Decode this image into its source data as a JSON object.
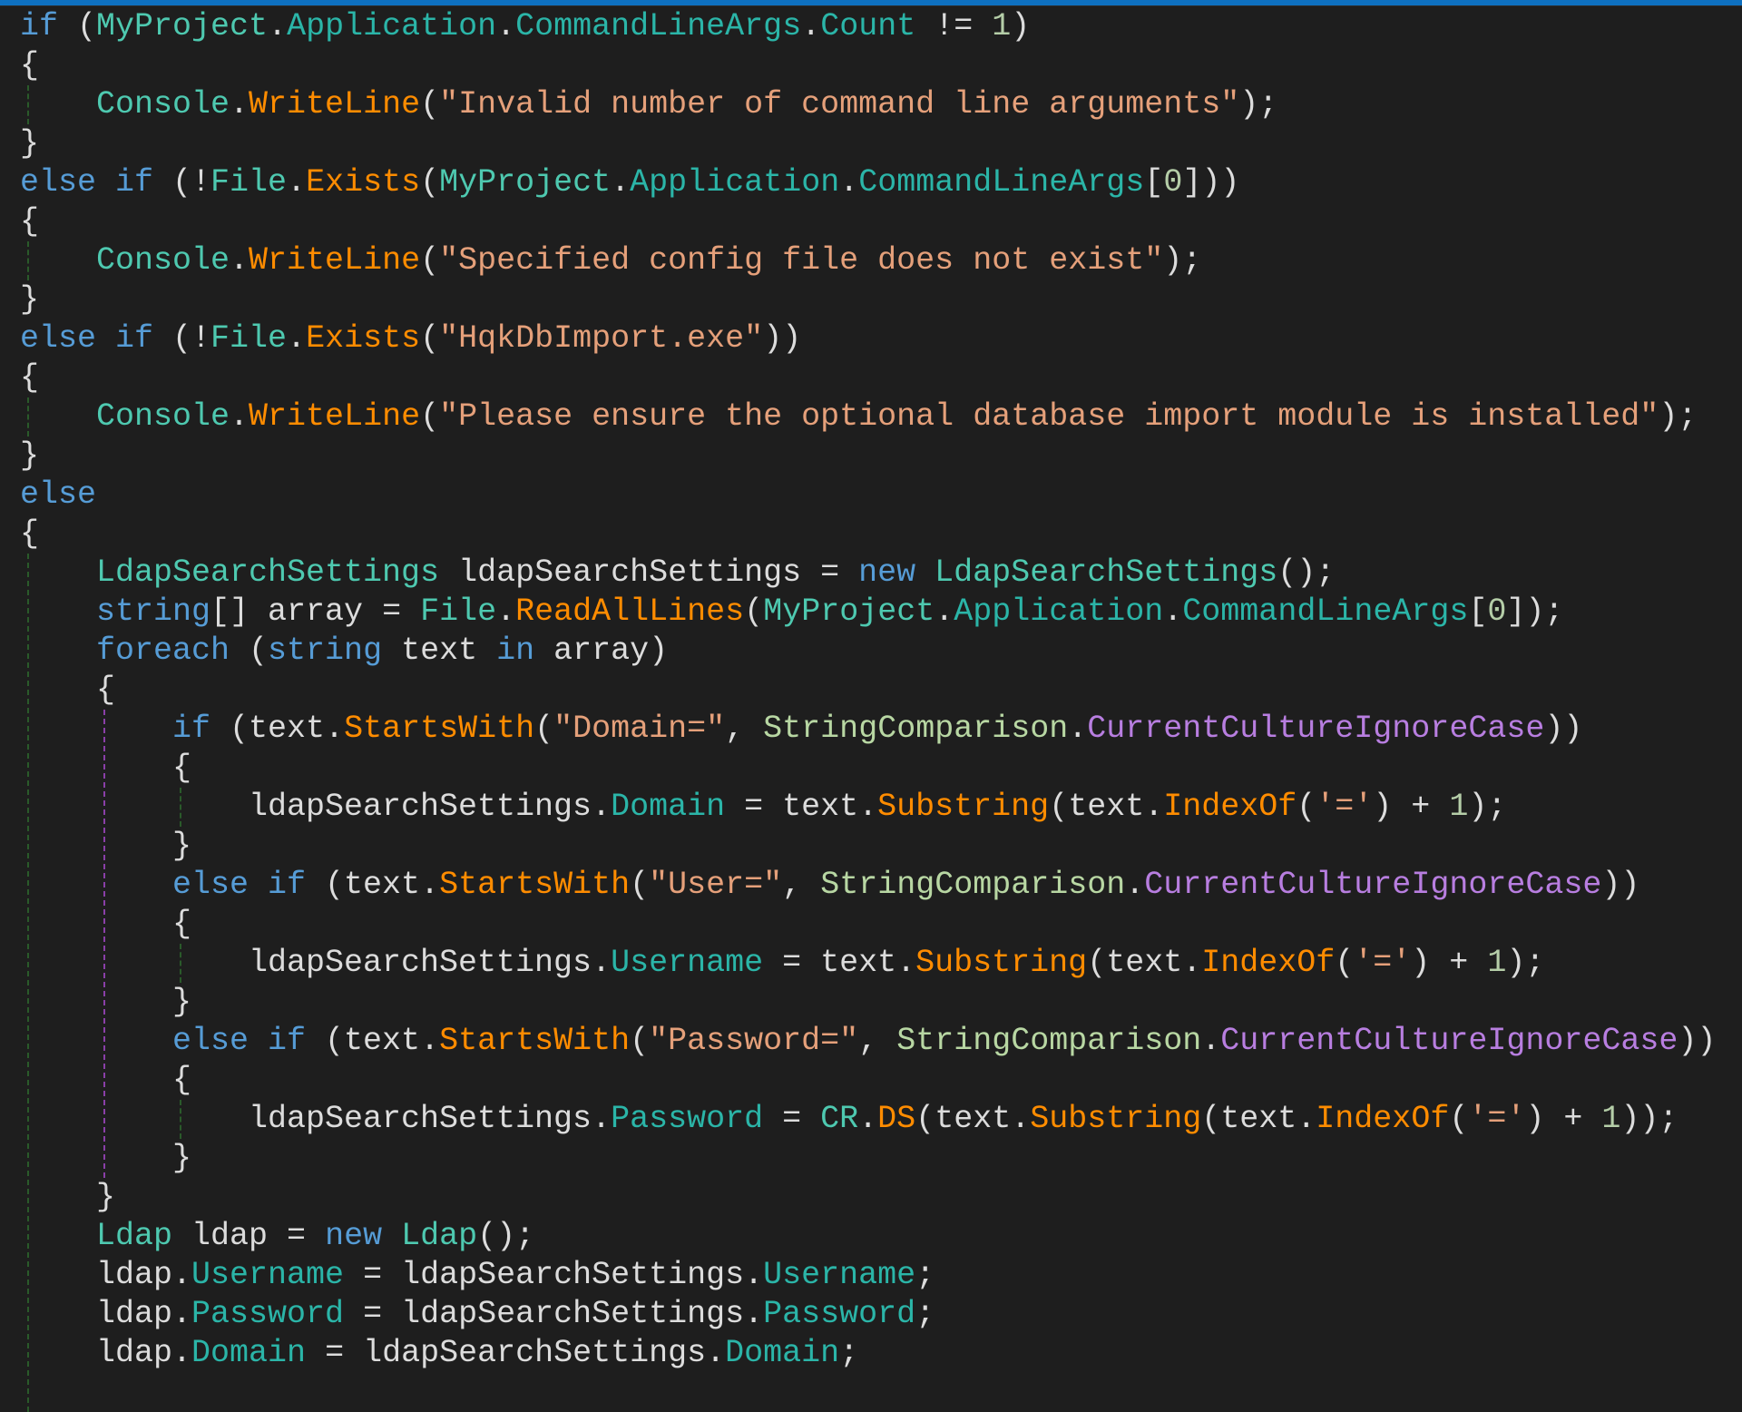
{
  "editor": {
    "accent_color": "#0e70c0",
    "background": "#1e1e1e",
    "language": "C#",
    "lines": [
      {
        "indent": 0,
        "tokens": [
          [
            "kw",
            "if"
          ],
          [
            "punc",
            " ("
          ],
          [
            "type",
            "MyProject"
          ],
          [
            "punc",
            "."
          ],
          [
            "prop",
            "Application"
          ],
          [
            "punc",
            "."
          ],
          [
            "prop",
            "CommandLineArgs"
          ],
          [
            "punc",
            "."
          ],
          [
            "prop",
            "Count"
          ],
          [
            "punc",
            " != "
          ],
          [
            "num",
            "1"
          ],
          [
            "punc",
            ")"
          ]
        ]
      },
      {
        "indent": 0,
        "tokens": [
          [
            "punc",
            "{"
          ]
        ]
      },
      {
        "indent": 1,
        "tokens": [
          [
            "static",
            "Console"
          ],
          [
            "punc",
            "."
          ],
          [
            "meth",
            "WriteLine"
          ],
          [
            "punc",
            "("
          ],
          [
            "str",
            "\"Invalid number of command line arguments\""
          ],
          [
            "punc",
            ");"
          ]
        ]
      },
      {
        "indent": 0,
        "tokens": [
          [
            "punc",
            "}"
          ]
        ]
      },
      {
        "indent": 0,
        "tokens": [
          [
            "kw",
            "else if"
          ],
          [
            "punc",
            " (!"
          ],
          [
            "static",
            "File"
          ],
          [
            "punc",
            "."
          ],
          [
            "meth",
            "Exists"
          ],
          [
            "punc",
            "("
          ],
          [
            "type",
            "MyProject"
          ],
          [
            "punc",
            "."
          ],
          [
            "prop",
            "Application"
          ],
          [
            "punc",
            "."
          ],
          [
            "prop",
            "CommandLineArgs"
          ],
          [
            "punc",
            "["
          ],
          [
            "num",
            "0"
          ],
          [
            "punc",
            "]))"
          ]
        ]
      },
      {
        "indent": 0,
        "tokens": [
          [
            "punc",
            "{"
          ]
        ]
      },
      {
        "indent": 1,
        "tokens": [
          [
            "static",
            "Console"
          ],
          [
            "punc",
            "."
          ],
          [
            "meth",
            "WriteLine"
          ],
          [
            "punc",
            "("
          ],
          [
            "str",
            "\"Specified config file does not exist\""
          ],
          [
            "punc",
            ");"
          ]
        ]
      },
      {
        "indent": 0,
        "tokens": [
          [
            "punc",
            "}"
          ]
        ]
      },
      {
        "indent": 0,
        "tokens": [
          [
            "kw",
            "else if"
          ],
          [
            "punc",
            " (!"
          ],
          [
            "static",
            "File"
          ],
          [
            "punc",
            "."
          ],
          [
            "meth",
            "Exists"
          ],
          [
            "punc",
            "("
          ],
          [
            "str",
            "\"HqkDbImport.exe\""
          ],
          [
            "punc",
            "))"
          ]
        ]
      },
      {
        "indent": 0,
        "tokens": [
          [
            "punc",
            "{"
          ]
        ]
      },
      {
        "indent": 1,
        "tokens": [
          [
            "static",
            "Console"
          ],
          [
            "punc",
            "."
          ],
          [
            "meth",
            "WriteLine"
          ],
          [
            "punc",
            "("
          ],
          [
            "str",
            "\"Please ensure the optional database import module is installed\""
          ],
          [
            "punc",
            ");"
          ]
        ]
      },
      {
        "indent": 0,
        "tokens": [
          [
            "punc",
            "}"
          ]
        ]
      },
      {
        "indent": 0,
        "tokens": [
          [
            "kw",
            "else"
          ]
        ]
      },
      {
        "indent": 0,
        "tokens": [
          [
            "punc",
            "{"
          ]
        ]
      },
      {
        "indent": 1,
        "tokens": [
          [
            "type",
            "LdapSearchSettings"
          ],
          [
            "plain",
            " ldapSearchSettings "
          ],
          [
            "punc",
            "= "
          ],
          [
            "kw",
            "new "
          ],
          [
            "type",
            "LdapSearchSettings"
          ],
          [
            "punc",
            "();"
          ]
        ]
      },
      {
        "indent": 1,
        "tokens": [
          [
            "kw",
            "string"
          ],
          [
            "punc",
            "[] "
          ],
          [
            "plain",
            "array "
          ],
          [
            "punc",
            "= "
          ],
          [
            "static",
            "File"
          ],
          [
            "punc",
            "."
          ],
          [
            "meth",
            "ReadAllLines"
          ],
          [
            "punc",
            "("
          ],
          [
            "type",
            "MyProject"
          ],
          [
            "punc",
            "."
          ],
          [
            "prop",
            "Application"
          ],
          [
            "punc",
            "."
          ],
          [
            "prop",
            "CommandLineArgs"
          ],
          [
            "punc",
            "["
          ],
          [
            "num",
            "0"
          ],
          [
            "punc",
            "]);"
          ]
        ]
      },
      {
        "indent": 1,
        "tokens": [
          [
            "kw",
            "foreach"
          ],
          [
            "punc",
            " ("
          ],
          [
            "kw",
            "string"
          ],
          [
            "plain",
            " text "
          ],
          [
            "kw",
            "in"
          ],
          [
            "plain",
            " array"
          ],
          [
            "punc",
            ")"
          ]
        ]
      },
      {
        "indent": 1,
        "tokens": [
          [
            "punc",
            "{"
          ]
        ]
      },
      {
        "indent": 2,
        "tokens": [
          [
            "kw",
            "if"
          ],
          [
            "punc",
            " ("
          ],
          [
            "plain",
            "text"
          ],
          [
            "punc",
            "."
          ],
          [
            "meth",
            "StartsWith"
          ],
          [
            "punc",
            "("
          ],
          [
            "str",
            "\"Domain=\""
          ],
          [
            "punc",
            ", "
          ],
          [
            "enumt",
            "StringComparison"
          ],
          [
            "punc",
            "."
          ],
          [
            "enumv",
            "CurrentCultureIgnoreCase"
          ],
          [
            "punc",
            "))"
          ]
        ]
      },
      {
        "indent": 2,
        "tokens": [
          [
            "punc",
            "{"
          ]
        ]
      },
      {
        "indent": 3,
        "tokens": [
          [
            "plain",
            "ldapSearchSettings"
          ],
          [
            "punc",
            "."
          ],
          [
            "prop",
            "Domain"
          ],
          [
            "punc",
            " = "
          ],
          [
            "plain",
            "text"
          ],
          [
            "punc",
            "."
          ],
          [
            "meth",
            "Substring"
          ],
          [
            "punc",
            "("
          ],
          [
            "plain",
            "text"
          ],
          [
            "punc",
            "."
          ],
          [
            "meth",
            "IndexOf"
          ],
          [
            "punc",
            "("
          ],
          [
            "str",
            "'='"
          ],
          [
            "punc",
            ") + "
          ],
          [
            "num",
            "1"
          ],
          [
            "punc",
            ");"
          ]
        ]
      },
      {
        "indent": 2,
        "tokens": [
          [
            "punc",
            "}"
          ]
        ]
      },
      {
        "indent": 2,
        "tokens": [
          [
            "kw",
            "else if"
          ],
          [
            "punc",
            " ("
          ],
          [
            "plain",
            "text"
          ],
          [
            "punc",
            "."
          ],
          [
            "meth",
            "StartsWith"
          ],
          [
            "punc",
            "("
          ],
          [
            "str",
            "\"User=\""
          ],
          [
            "punc",
            ", "
          ],
          [
            "enumt",
            "StringComparison"
          ],
          [
            "punc",
            "."
          ],
          [
            "enumv",
            "CurrentCultureIgnoreCase"
          ],
          [
            "punc",
            "))"
          ]
        ]
      },
      {
        "indent": 2,
        "tokens": [
          [
            "punc",
            "{"
          ]
        ]
      },
      {
        "indent": 3,
        "tokens": [
          [
            "plain",
            "ldapSearchSettings"
          ],
          [
            "punc",
            "."
          ],
          [
            "prop",
            "Username"
          ],
          [
            "punc",
            " = "
          ],
          [
            "plain",
            "text"
          ],
          [
            "punc",
            "."
          ],
          [
            "meth",
            "Substring"
          ],
          [
            "punc",
            "("
          ],
          [
            "plain",
            "text"
          ],
          [
            "punc",
            "."
          ],
          [
            "meth",
            "IndexOf"
          ],
          [
            "punc",
            "("
          ],
          [
            "str",
            "'='"
          ],
          [
            "punc",
            ") + "
          ],
          [
            "num",
            "1"
          ],
          [
            "punc",
            ");"
          ]
        ]
      },
      {
        "indent": 2,
        "tokens": [
          [
            "punc",
            "}"
          ]
        ]
      },
      {
        "indent": 2,
        "tokens": [
          [
            "kw",
            "else if"
          ],
          [
            "punc",
            " ("
          ],
          [
            "plain",
            "text"
          ],
          [
            "punc",
            "."
          ],
          [
            "meth",
            "StartsWith"
          ],
          [
            "punc",
            "("
          ],
          [
            "str",
            "\"Password=\""
          ],
          [
            "punc",
            ", "
          ],
          [
            "enumt",
            "StringComparison"
          ],
          [
            "punc",
            "."
          ],
          [
            "enumv",
            "CurrentCultureIgnoreCase"
          ],
          [
            "punc",
            "))"
          ]
        ]
      },
      {
        "indent": 2,
        "tokens": [
          [
            "punc",
            "{"
          ]
        ]
      },
      {
        "indent": 3,
        "tokens": [
          [
            "plain",
            "ldapSearchSettings"
          ],
          [
            "punc",
            "."
          ],
          [
            "prop",
            "Password"
          ],
          [
            "punc",
            " = "
          ],
          [
            "static",
            "CR"
          ],
          [
            "punc",
            "."
          ],
          [
            "meth",
            "DS"
          ],
          [
            "punc",
            "("
          ],
          [
            "plain",
            "text"
          ],
          [
            "punc",
            "."
          ],
          [
            "meth",
            "Substring"
          ],
          [
            "punc",
            "("
          ],
          [
            "plain",
            "text"
          ],
          [
            "punc",
            "."
          ],
          [
            "meth",
            "IndexOf"
          ],
          [
            "punc",
            "("
          ],
          [
            "str",
            "'='"
          ],
          [
            "punc",
            ") + "
          ],
          [
            "num",
            "1"
          ],
          [
            "punc",
            "));"
          ]
        ]
      },
      {
        "indent": 2,
        "tokens": [
          [
            "punc",
            "}"
          ]
        ]
      },
      {
        "indent": 1,
        "tokens": [
          [
            "punc",
            "}"
          ]
        ]
      },
      {
        "indent": 1,
        "tokens": [
          [
            "type",
            "Ldap"
          ],
          [
            "plain",
            " ldap "
          ],
          [
            "punc",
            "= "
          ],
          [
            "kw",
            "new "
          ],
          [
            "type",
            "Ldap"
          ],
          [
            "punc",
            "();"
          ]
        ]
      },
      {
        "indent": 1,
        "tokens": [
          [
            "plain",
            "ldap"
          ],
          [
            "punc",
            "."
          ],
          [
            "prop",
            "Username"
          ],
          [
            "punc",
            " = "
          ],
          [
            "plain",
            "ldapSearchSettings"
          ],
          [
            "punc",
            "."
          ],
          [
            "prop",
            "Username"
          ],
          [
            "punc",
            ";"
          ]
        ]
      },
      {
        "indent": 1,
        "tokens": [
          [
            "plain",
            "ldap"
          ],
          [
            "punc",
            "."
          ],
          [
            "prop",
            "Password"
          ],
          [
            "punc",
            " = "
          ],
          [
            "plain",
            "ldapSearchSettings"
          ],
          [
            "punc",
            "."
          ],
          [
            "prop",
            "Password"
          ],
          [
            "punc",
            ";"
          ]
        ]
      },
      {
        "indent": 1,
        "tokens": [
          [
            "plain",
            "ldap"
          ],
          [
            "punc",
            "."
          ],
          [
            "prop",
            "Domain"
          ],
          [
            "punc",
            " = "
          ],
          [
            "plain",
            "ldapSearchSettings"
          ],
          [
            "punc",
            "."
          ],
          [
            "prop",
            "Domain"
          ],
          [
            "punc",
            ";"
          ]
        ]
      }
    ]
  }
}
